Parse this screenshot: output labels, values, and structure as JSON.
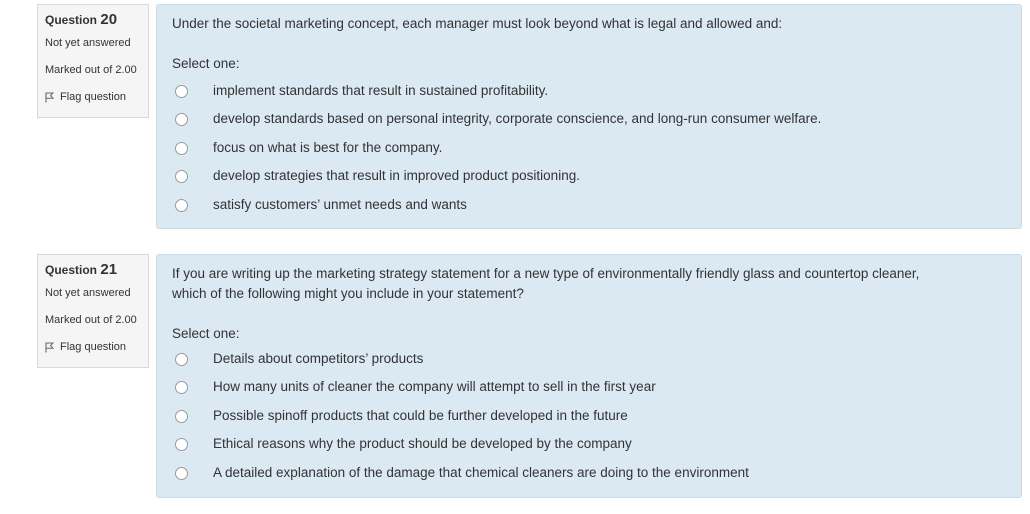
{
  "questions": [
    {
      "label": "Question",
      "number": "20",
      "state": "Not yet answered",
      "grade": "Marked out of 2.00",
      "flag": "Flag question",
      "text_lines": [
        "Under the societal marketing concept, each manager must look beyond what is legal and allowed and:"
      ],
      "prompt": "Select one:",
      "answers": [
        "implement standards that result in sustained profitability.",
        "develop standards based on personal integrity, corporate conscience, and long-run consumer welfare.",
        "focus on what is best for the company.",
        "develop strategies that result in improved product positioning.",
        "satisfy customers’ unmet needs and wants"
      ]
    },
    {
      "label": "Question",
      "number": "21",
      "state": "Not yet answered",
      "grade": "Marked out of 2.00",
      "flag": "Flag question",
      "text_lines": [
        "If you are writing up the marketing strategy statement for a new type of environmentally friendly glass and countertop cleaner,",
        "which of the following might you include in your statement?"
      ],
      "prompt": "Select one:",
      "answers": [
        "Details about competitors’ products",
        "How many units of cleaner the company will attempt to sell in the first year",
        "Possible spinoff products that could be further developed in the future",
        "Ethical reasons why the product should be developed by the company",
        "A detailed explanation of the damage that chemical cleaners are doing to the environment"
      ]
    }
  ],
  "colors": {
    "content_bg": "#dbe9f3",
    "info_bg": "#f5f5f5"
  }
}
